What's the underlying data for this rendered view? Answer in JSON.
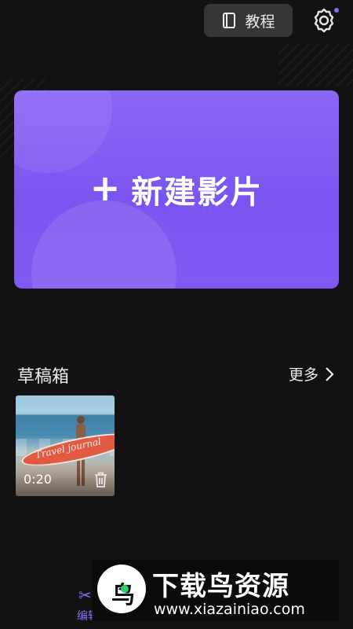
{
  "header": {
    "tutorial_label": "教程",
    "book_icon": "book-icon",
    "settings_icon": "gear-icon",
    "notification_dot_color": "#8a6cf2"
  },
  "new_project": {
    "plus_icon": "plus-icon",
    "label": "新建影片",
    "accent_color": "#7e5af2"
  },
  "drafts": {
    "title": "草稿箱",
    "more_label": "更多",
    "chevron_icon": "chevron-right-icon",
    "items": [
      {
        "duration": "0:20",
        "thumbnail_text": "Travel journal",
        "delete_icon": "trash-icon"
      }
    ]
  },
  "bottom_nav": {
    "edit_label": "编辑",
    "edit_icon": "scissors-icon",
    "active_color": "#8a6cf2"
  },
  "watermark": {
    "title": "下载鸟资源",
    "url": "www.xiazainiao.com"
  }
}
